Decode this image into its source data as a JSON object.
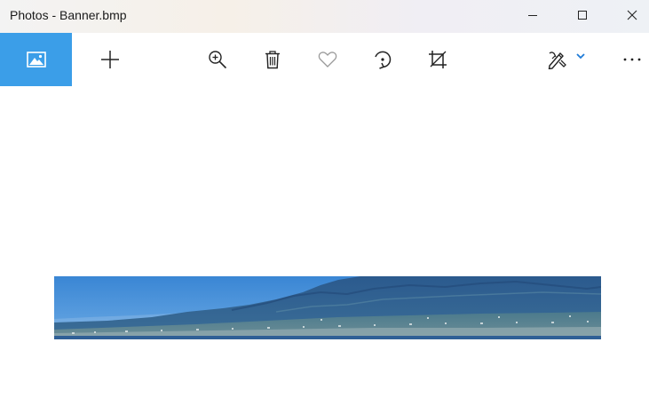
{
  "window": {
    "title": "Photos - Banner.bmp",
    "controls": {
      "minimize_icon": "minimize-icon",
      "maximize_icon": "maximize-icon",
      "close_icon": "close-icon"
    }
  },
  "toolbar": {
    "accent_color": "#3b9ee8",
    "buttons": [
      {
        "id": "collection",
        "icon": "picture-icon"
      },
      {
        "id": "add",
        "icon": "plus-icon"
      },
      {
        "id": "zoom",
        "icon": "zoom-in-icon"
      },
      {
        "id": "delete",
        "icon": "trash-icon"
      },
      {
        "id": "favorite",
        "icon": "heart-icon"
      },
      {
        "id": "rotate",
        "icon": "rotate-icon"
      },
      {
        "id": "crop",
        "icon": "crop-icon"
      },
      {
        "id": "edit",
        "icon": "edit-create-icon"
      },
      {
        "id": "more",
        "icon": "ellipsis-icon"
      }
    ]
  },
  "viewer": {
    "image_description_icon": "landscape-banner-image"
  }
}
